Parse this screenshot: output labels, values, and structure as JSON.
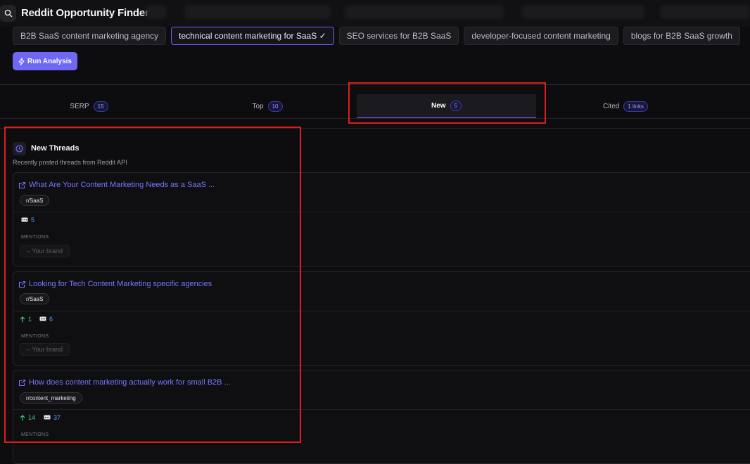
{
  "app": {
    "title": "Reddit Opportunity Finder"
  },
  "keywords": [
    {
      "label": "B2B SaaS content marketing agency"
    },
    {
      "label": "technical content marketing for SaaS ✓"
    },
    {
      "label": "SEO services for B2B SaaS"
    },
    {
      "label": "developer-focused content marketing"
    },
    {
      "label": "blogs for B2B SaaS growth"
    }
  ],
  "actions": {
    "run_label": "Run Analysis"
  },
  "tabs": [
    {
      "label": "SERP",
      "count": "15"
    },
    {
      "label": "Top",
      "count": "10"
    },
    {
      "label": "New",
      "count": "5"
    },
    {
      "label": "Cited",
      "count": "1 links"
    }
  ],
  "active_tab": "New",
  "section": {
    "title": "New Threads",
    "subtitle": "Recently posted threads from Reddit API"
  },
  "threads": [
    {
      "title": "What Are Your Content Marketing Needs as a SaaS ...",
      "subreddit": "r/SaaS",
      "upvotes": null,
      "comments": "5",
      "mentions_label": "MENTIONS",
      "brand": "– Your brand"
    },
    {
      "title": "Looking for Tech Content Marketing specific agencies",
      "subreddit": "r/SaaS",
      "upvotes": "1",
      "comments": "6",
      "mentions_label": "MENTIONS",
      "brand": "– Your brand"
    },
    {
      "title": "How does content marketing actually work for small B2B ...",
      "subreddit": "r/content_marketing",
      "upvotes": "14",
      "comments": "37",
      "mentions_label": "MENTIONS",
      "brand": ""
    }
  ],
  "colors": {
    "accent": "#6c63ff",
    "link": "#7b74ff",
    "upvote": "#3fd07a",
    "comment": "#5aa1ff",
    "highlight": "#e01b1b"
  },
  "icons": [
    "search-icon",
    "lightning-icon",
    "clock-icon",
    "external-link-icon",
    "arrow-up-icon",
    "comment-icon"
  ]
}
